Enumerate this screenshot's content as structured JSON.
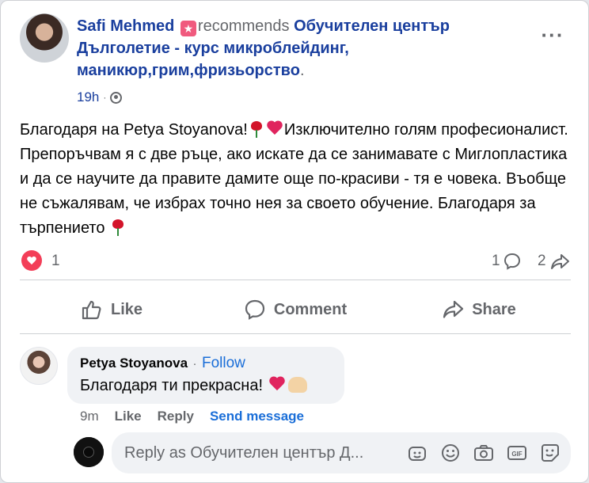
{
  "post": {
    "author": "Safi Mehmed",
    "verb": "recommends",
    "page_name": "Обучителен център Дълголетие - курс микроблейдинг, маникюр,грим,фризьорство",
    "period": ".",
    "time": "19h",
    "separator": "·",
    "text_part1": "Благодаря на Petya Stoyanova!",
    "text_part2": "Изключително голям професионалист. Препоръчвам я с две ръце, ако искате да се занимавате с Миглопластика и да се научите да правите дамите още по-красиви - тя е човека. Въобще не съжалявам, че избрах точно нея за своето обучение. Благодаря за търпението",
    "reaction_count": "1",
    "comment_count": "1",
    "share_count": "2"
  },
  "actions": {
    "like": "Like",
    "comment": "Comment",
    "share": "Share"
  },
  "comment": {
    "author": "Petya Stoyanova",
    "dot": "·",
    "follow": "Follow",
    "text": "Благодаря ти прекрасна!",
    "time": "9m",
    "like": "Like",
    "reply": "Reply",
    "send_message": "Send message"
  },
  "reply": {
    "placeholder": "Reply as Обучителен център Д..."
  },
  "colors": {
    "link_blue": "#1a3f9e",
    "action_blue": "#1a6ed8",
    "muted": "#65676b",
    "love": "#f33e58"
  },
  "icons": [
    "recommend-star-icon",
    "globe-icon",
    "more-icon",
    "love-reaction-icon",
    "comment-count-icon",
    "share-count-icon",
    "like-icon",
    "comment-icon",
    "share-icon",
    "avatar-sticker-icon",
    "emoji-icon",
    "camera-icon",
    "gif-icon",
    "sticker-icon"
  ]
}
